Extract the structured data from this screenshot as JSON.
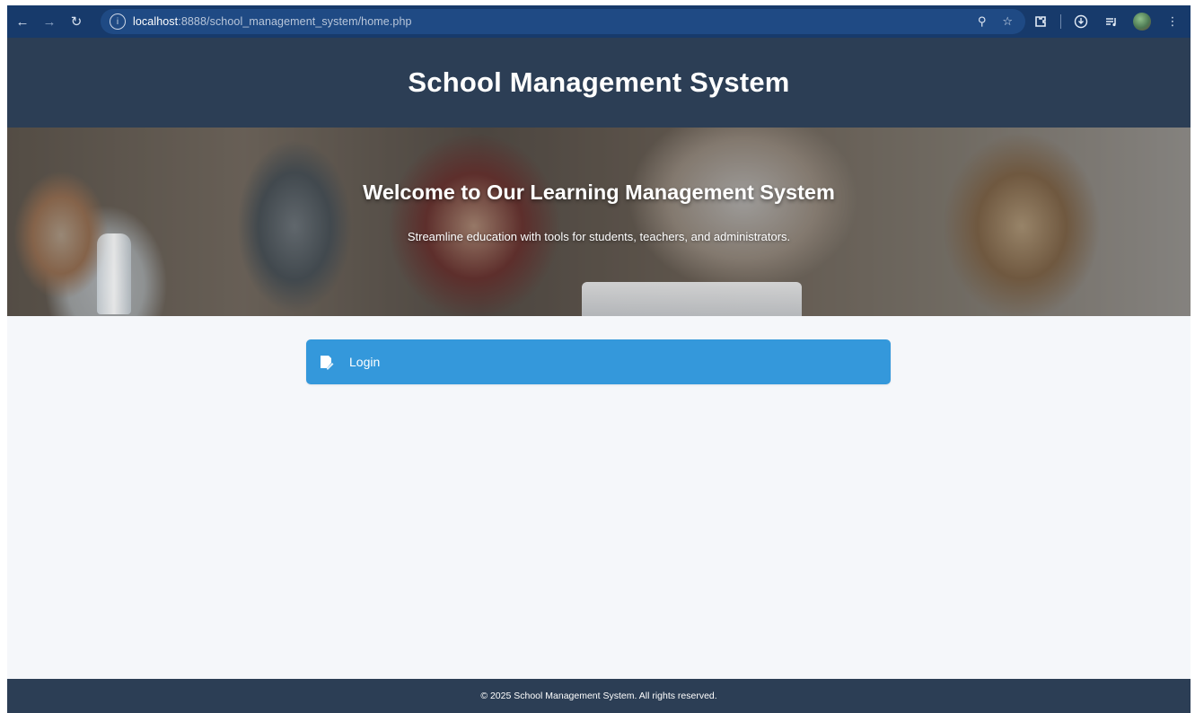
{
  "browser": {
    "url_host": "localhost",
    "url_rest": ":8888/school_management_system/home.php",
    "icons": {
      "back": "arrow-left-icon",
      "forward": "arrow-right-icon",
      "reload": "reload-icon",
      "site_info": "info-icon",
      "zoom": "zoom-icon",
      "bookmark": "star-icon",
      "extensions": "puzzle-icon",
      "download": "download-icon",
      "media": "media-icon",
      "menu": "kebab-menu-icon"
    }
  },
  "header": {
    "title": "School Management System"
  },
  "hero": {
    "title": "Welcome to Our Learning Management System",
    "subtitle": "Streamline education with tools for students, teachers, and administrators."
  },
  "login": {
    "label": "Login",
    "icon": "login-icon"
  },
  "footer": {
    "text": "© 2025 School Management System. All rights reserved."
  },
  "colors": {
    "header_bg": "#2c3e55",
    "accent": "#3498db",
    "page_bg": "#f5f7fa",
    "browser_bar": "#173a6b"
  }
}
